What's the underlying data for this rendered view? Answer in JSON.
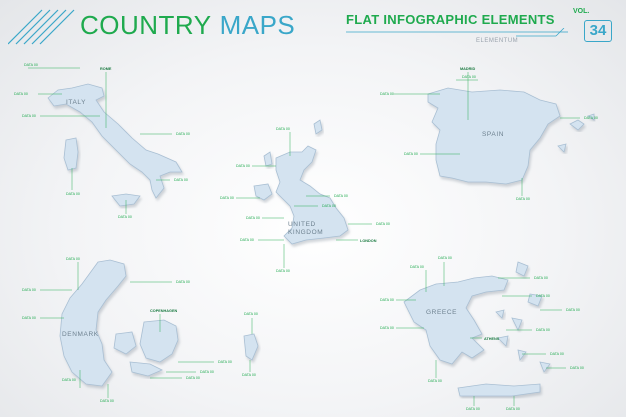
{
  "header": {
    "title_word1": "COUNTRY",
    "title_word2": "MAPS",
    "subtitle": "FLAT INFOGRAPHIC ELEMENTS",
    "brand": "ELEMENTUM",
    "vol_label": "VOL.",
    "vol_number": "34"
  },
  "colors": {
    "green": "#1faa4e",
    "blue": "#3aa7c9",
    "land": "#d4e3f0",
    "outline": "#a9bfd3"
  },
  "point_label": "DATA 00",
  "maps": {
    "italy": {
      "name": "ITALY",
      "capital": "ROME"
    },
    "spain": {
      "name": "SPAIN",
      "capital": "MADRID"
    },
    "uk": {
      "name_line1": "UNITED",
      "name_line2": "KINGDOM",
      "capital": "LONDON"
    },
    "denmark": {
      "name": "DENMARK",
      "capital": "COPENHAGEN"
    },
    "greece": {
      "name": "GREECE",
      "capital": "ATHENS"
    }
  }
}
